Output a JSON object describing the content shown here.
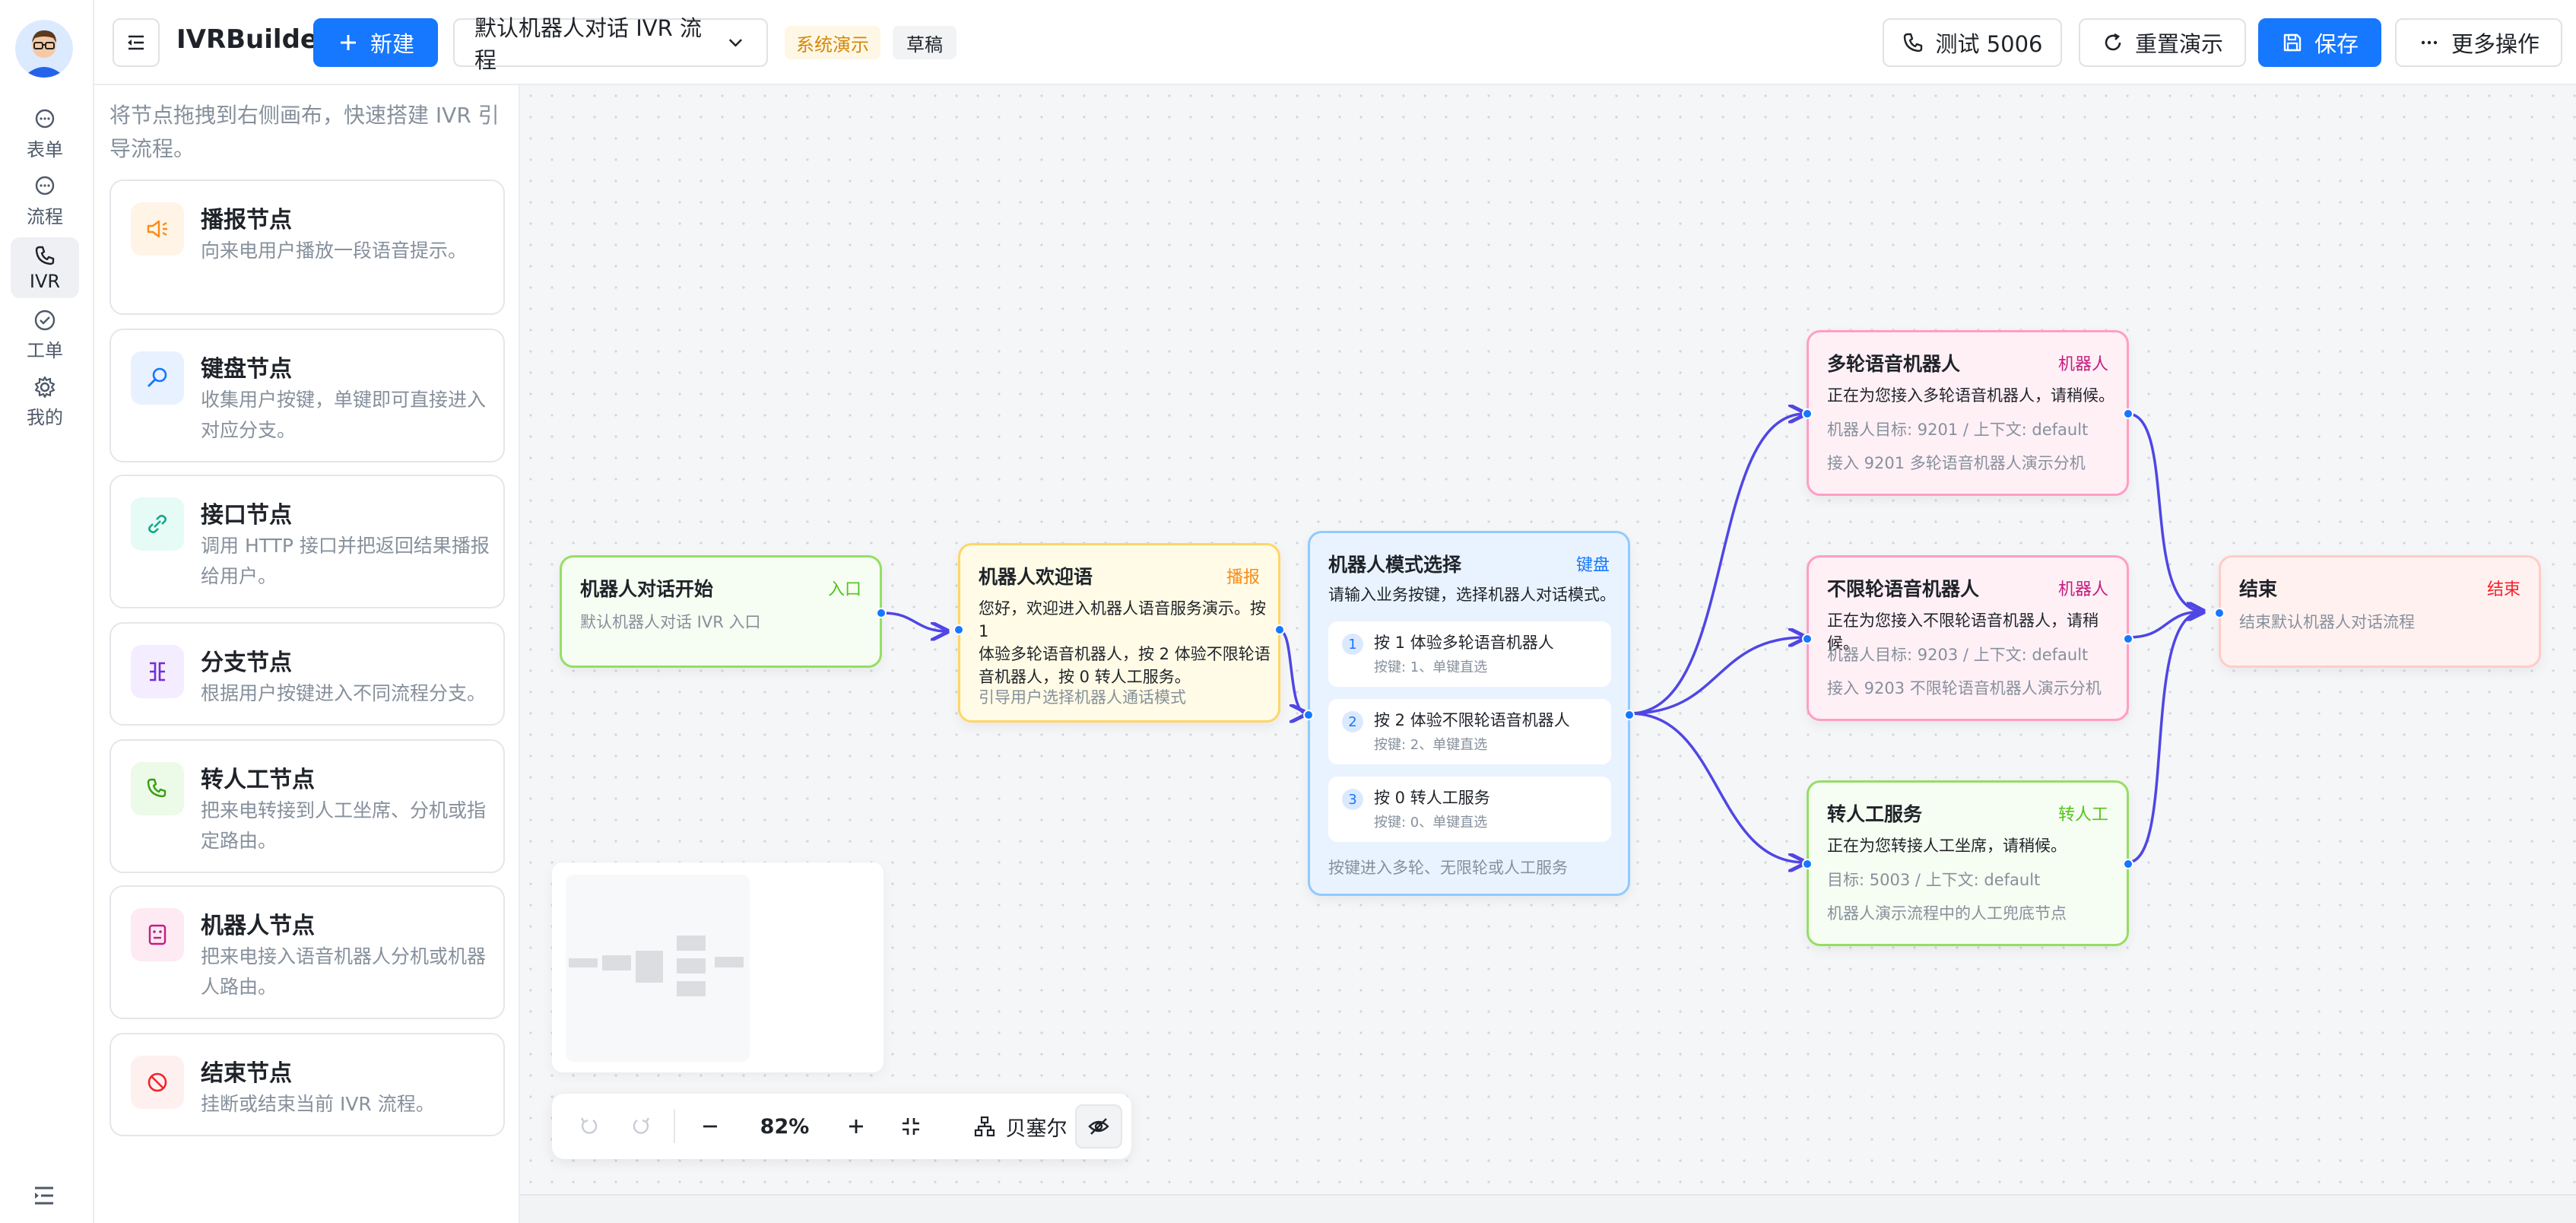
{
  "app": {
    "title": "IVRBuilder",
    "new_label": "新建",
    "flow_name": "默认机器人对话 IVR 流程",
    "tag_demo": "系统演示",
    "tag_draft": "草稿",
    "test_label": "测试 5006",
    "reset_label": "重置演示",
    "save_label": "保存",
    "more_label": "更多操作",
    "colors": {
      "primary": "#1677ff",
      "tag_demo_bg": "#fff7e6",
      "tag_demo_fg": "#d48806"
    }
  },
  "rail": {
    "items": [
      {
        "label": "表单",
        "icon": "chat-bubble-icon"
      },
      {
        "label": "流程",
        "icon": "chat-bubble-icon"
      },
      {
        "label": "IVR",
        "icon": "phone-icon",
        "active": true
      },
      {
        "label": "工单",
        "icon": "check-circle-icon"
      },
      {
        "label": "我的",
        "icon": "gear-icon"
      }
    ]
  },
  "palette": {
    "hint": "将节点拖拽到右侧画布，快速搭建 IVR 引导流程。",
    "cards": [
      {
        "title": "播报节点",
        "desc": "向来电用户播放一段语音提示。",
        "icon": "speaker-icon"
      },
      {
        "title": "键盘节点",
        "desc": "收集用户按键，单键即可直接进入对应分支。",
        "icon": "search-key-icon"
      },
      {
        "title": "接口节点",
        "desc": "调用 HTTP 接口并把返回结果播报给用户。",
        "icon": "link-icon"
      },
      {
        "title": "分支节点",
        "desc": "根据用户按键进入不同流程分支。",
        "icon": "branch-icon"
      },
      {
        "title": "转人工节点",
        "desc": "把来电转接到人工坐席、分机或指定路由。",
        "icon": "phone-icon"
      },
      {
        "title": "机器人节点",
        "desc": "把来电接入语音机器人分机或机器人路由。",
        "icon": "robot-icon"
      },
      {
        "title": "结束节点",
        "desc": "挂断或结束当前 IVR 流程。",
        "icon": "ban-icon"
      }
    ]
  },
  "nodes": {
    "start": {
      "title": "机器人对话开始",
      "badge": "入口",
      "desc": "默认机器人对话 IVR 入口"
    },
    "welcome": {
      "title": "机器人欢迎语",
      "badge": "播报",
      "desc_lines": [
        "您好，欢迎进入机器人语音服务演示。按 1",
        "体验多轮语音机器人，按 2 体验不限轮语",
        "音机器人，按 0 转人工服务。"
      ],
      "meta": "引导用户选择机器人通话模式"
    },
    "select": {
      "title": "机器人模式选择",
      "badge": "键盘",
      "desc": "请输入业务按键，选择机器人对话模式。",
      "options": [
        {
          "num": "1",
          "label": "按 1 体验多轮语音机器人",
          "sub": "按键: 1、单键直选"
        },
        {
          "num": "2",
          "label": "按 2 体验不限轮语音机器人",
          "sub": "按键: 2、单键直选"
        },
        {
          "num": "3",
          "label": "按 0 转人工服务",
          "sub": "按键: 0、单键直选"
        }
      ],
      "footer": "按键进入多轮、无限轮或人工服务"
    },
    "multi": {
      "title": "多轮语音机器人",
      "badge": "机器人",
      "desc": "正在为您接入多轮语音机器人，请稍候。",
      "meta1": "机器人目标: 9201 / 上下文: default",
      "meta2": "接入 9201 多轮语音机器人演示分机"
    },
    "unlimited": {
      "title": "不限轮语音机器人",
      "badge": "机器人",
      "desc": "正在为您接入不限轮语音机器人，请稍候。",
      "meta1": "机器人目标: 9203 / 上下文: default",
      "meta2": "接入 9203 不限轮语音机器人演示分机"
    },
    "human": {
      "title": "转人工服务",
      "badge": "转人工",
      "desc": "正在为您转接人工坐席，请稍候。",
      "meta1": "目标: 5003 / 上下文: default",
      "meta2": "机器人演示流程中的人工兜底节点"
    },
    "end": {
      "title": "结束",
      "badge": "结束",
      "desc": "结束默认机器人对话流程"
    }
  },
  "toolbar": {
    "zoom": "82%",
    "layout_label": "贝塞尔"
  }
}
